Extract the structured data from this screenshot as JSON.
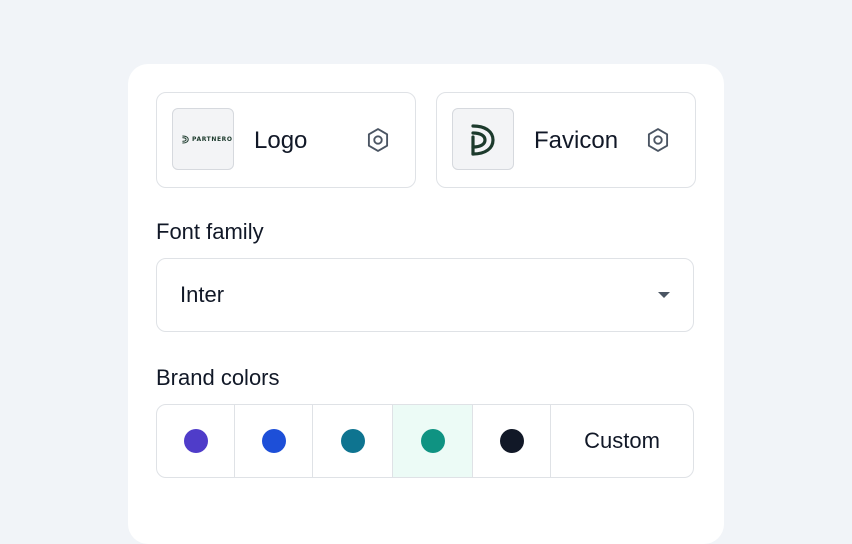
{
  "assets": {
    "logo": {
      "label": "Logo",
      "wordmark": "PARTNERO",
      "settings_icon": "gear-icon"
    },
    "favicon": {
      "label": "Favicon",
      "settings_icon": "gear-icon"
    }
  },
  "font": {
    "label": "Font family",
    "value": "Inter",
    "icon": "chevron-down-icon"
  },
  "brand_colors": {
    "label": "Brand colors",
    "swatches": [
      {
        "color": "#4f3cc9",
        "selected": false
      },
      {
        "color": "#1d4fd8",
        "selected": false
      },
      {
        "color": "#0e7490",
        "selected": false
      },
      {
        "color": "#0f9382",
        "selected": true
      },
      {
        "color": "#111827",
        "selected": false
      }
    ],
    "custom_label": "Custom"
  },
  "theme": {
    "brand_green": "#1c3a2c",
    "border": "#dfe2e6",
    "icon_gray": "#4b5563"
  }
}
